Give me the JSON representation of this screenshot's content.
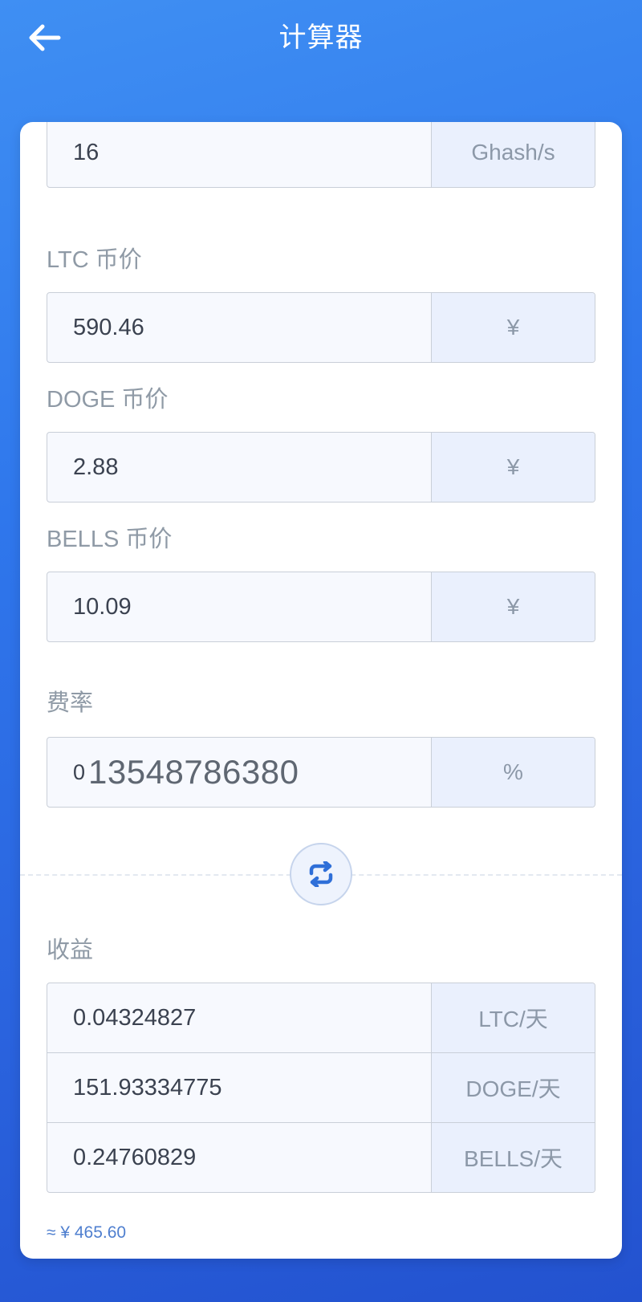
{
  "header": {
    "title": "计算器",
    "back_icon": "arrow-left-icon"
  },
  "hashrate": {
    "value": "16",
    "unit": "Ghash/s"
  },
  "ltc_price": {
    "label": "LTC 币价",
    "value": "590.46",
    "unit": "¥"
  },
  "doge_price": {
    "label": "DOGE 币价",
    "value": "2.88",
    "unit": "¥"
  },
  "bells_price": {
    "label": "BELLS 币价",
    "value": "10.09",
    "unit": "¥"
  },
  "fee": {
    "label": "费率",
    "value_prefix": "0",
    "value_overlay": "13548786380",
    "unit": "%"
  },
  "swap_icon": "refresh-swap-icon",
  "earnings": {
    "label": "收益",
    "rows": [
      {
        "value": "0.04324827",
        "unit": "LTC/天"
      },
      {
        "value": "151.93334775",
        "unit": "DOGE/天"
      },
      {
        "value": "0.24760829",
        "unit": "BELLS/天"
      }
    ],
    "total": "≈ ¥ 465.60"
  },
  "colors": {
    "accent": "#2f77ec",
    "unit_bg": "#eaf0fd",
    "total_text": "#4f7fcf"
  }
}
